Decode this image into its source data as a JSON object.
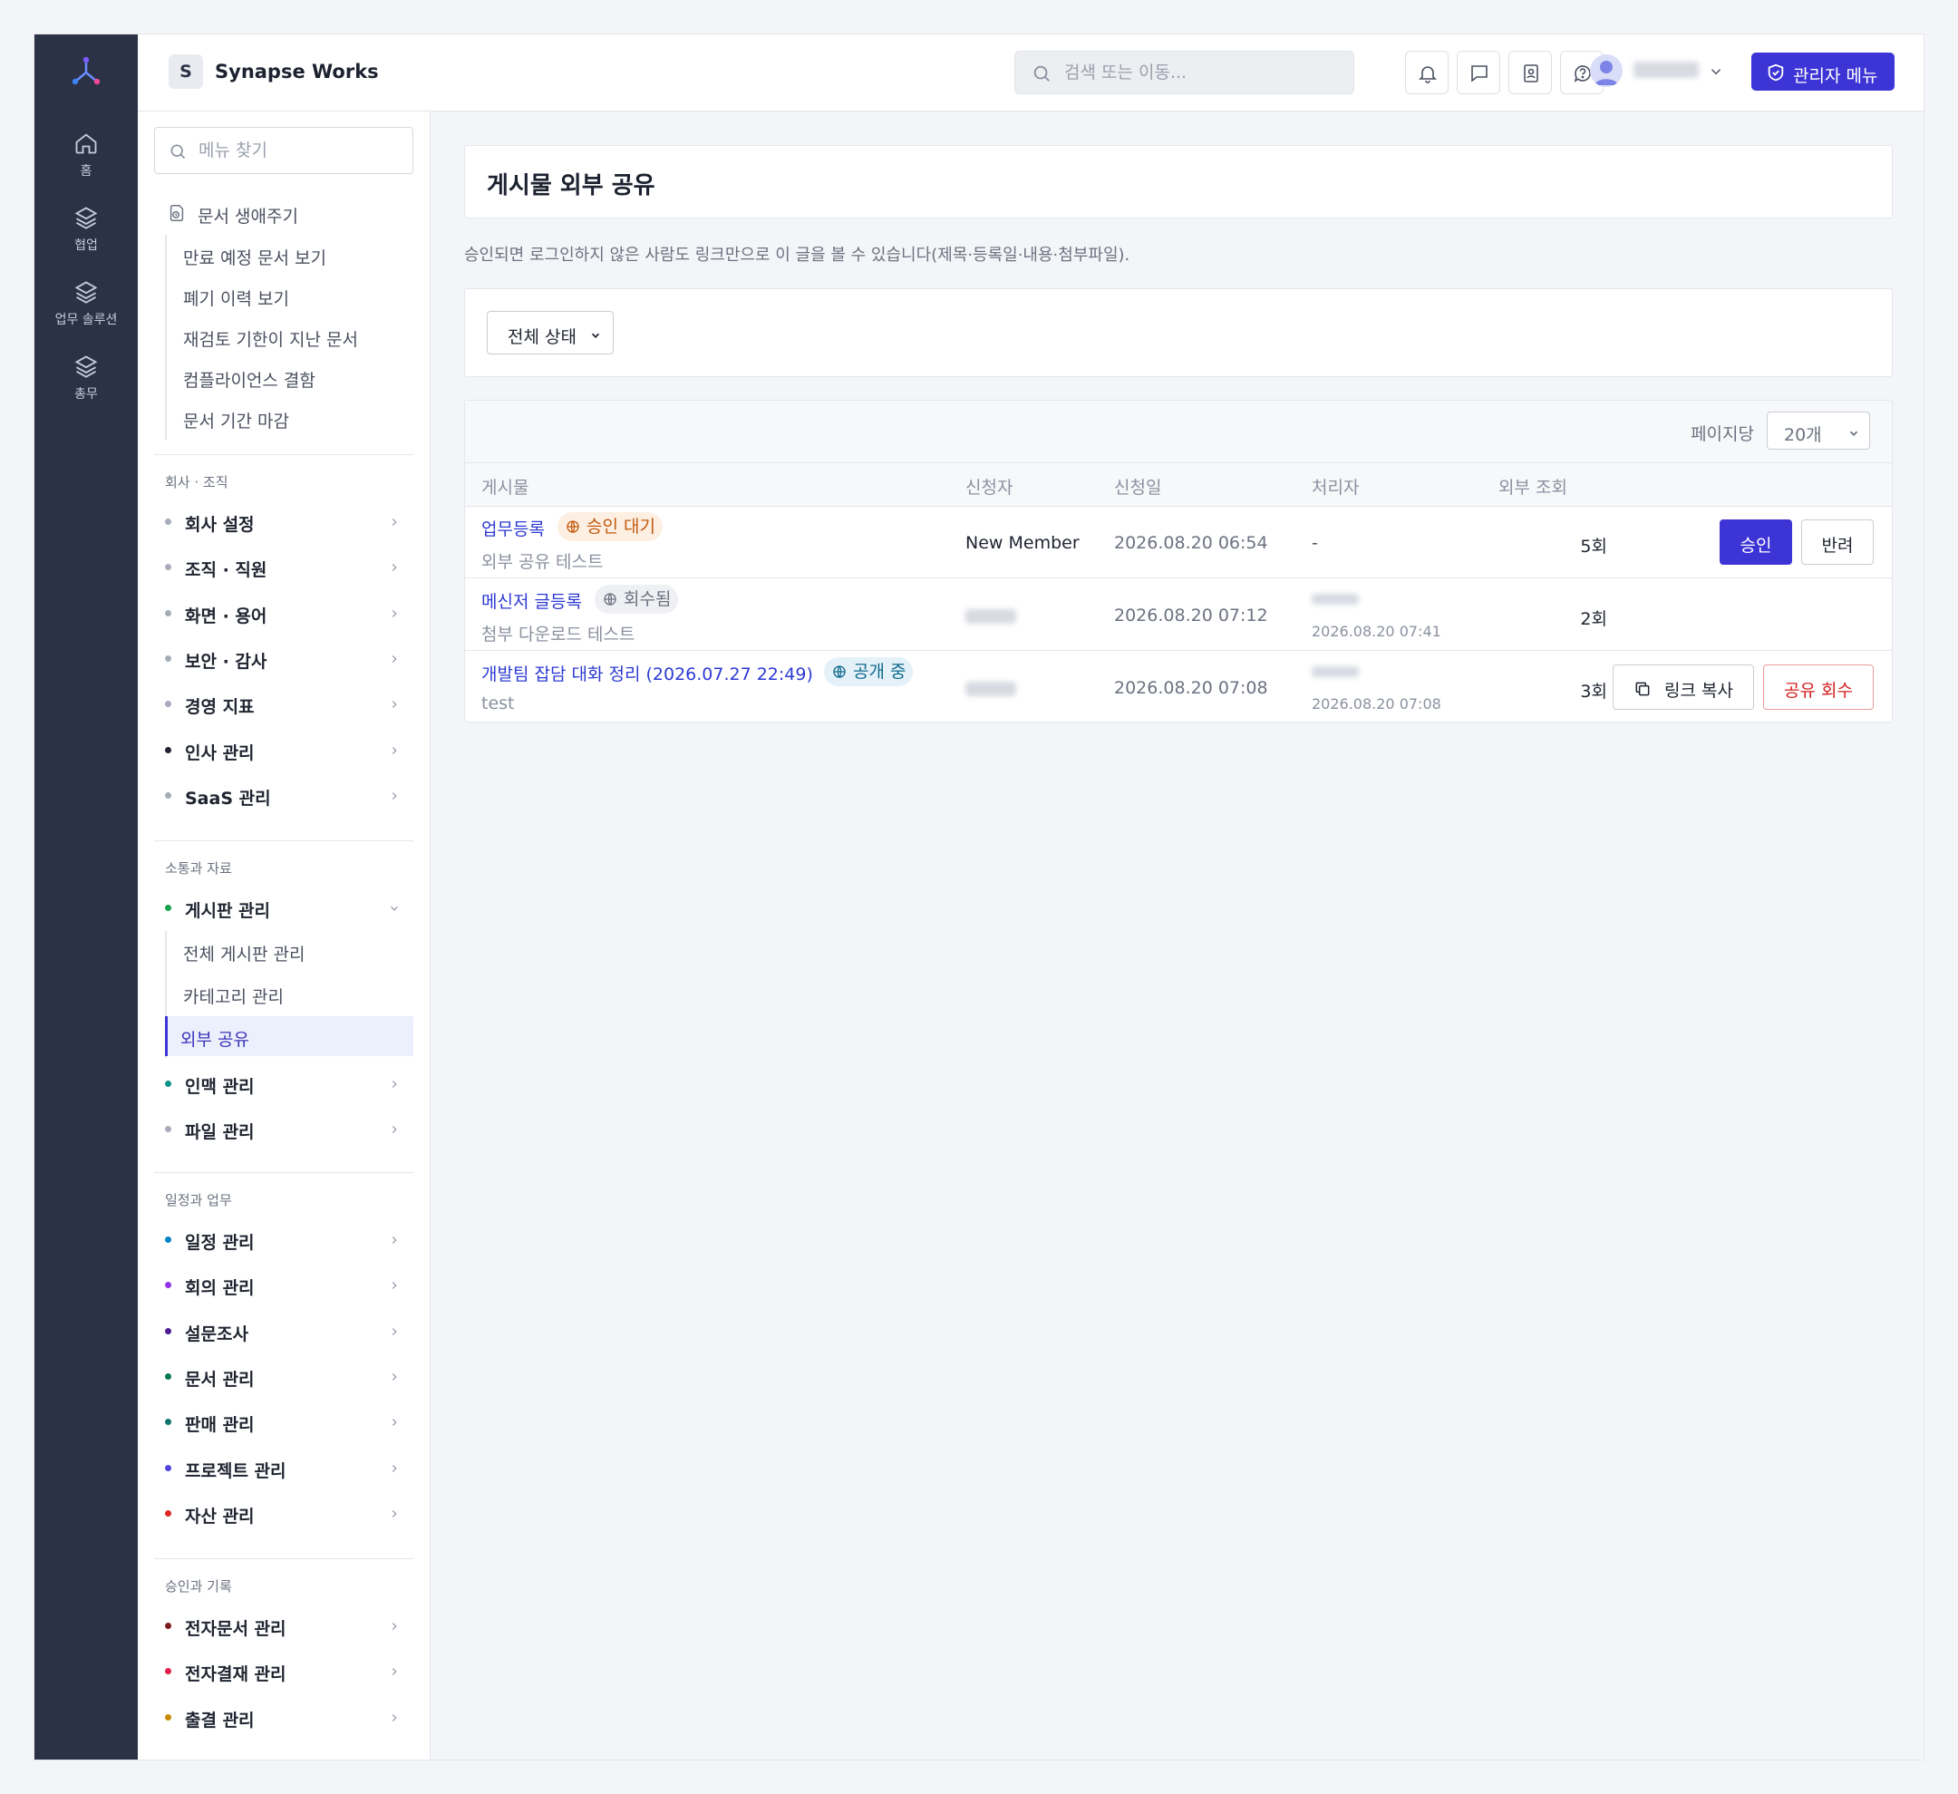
{
  "rail": {
    "items": [
      {
        "label": "홈",
        "icon": "home-icon"
      },
      {
        "label": "협업",
        "icon": "layers-icon"
      },
      {
        "label": "업무 솔루션",
        "icon": "layers-icon"
      },
      {
        "label": "총무",
        "icon": "layers-icon"
      }
    ]
  },
  "topbar": {
    "workspace_badge": "S",
    "workspace_name": "Synapse Works",
    "search_placeholder": "검색 또는 이동...",
    "admin_label": "관리자 메뉴"
  },
  "sidebar": {
    "search_placeholder": "메뉴 찾기",
    "lifecycle": {
      "label": "문서 생애주기",
      "items": [
        "만료 예정 문서 보기",
        "폐기 이력 보기",
        "재검토 기한이 지난 문서",
        "컴플라이언스 결함",
        "문서 기간 마감"
      ]
    },
    "sections": [
      {
        "title": "회사 · 조직",
        "items": [
          {
            "label": "회사 설정",
            "color": "#a7adb8"
          },
          {
            "label": "조직 · 직원",
            "color": "#a7adb8"
          },
          {
            "label": "화면 · 용어",
            "color": "#a7adb8"
          },
          {
            "label": "보안 · 감사",
            "color": "#a7adb8"
          },
          {
            "label": "경영 지표",
            "color": "#a7adb8"
          },
          {
            "label": "인사 관리",
            "color": "#1f2430"
          },
          {
            "label": "SaaS 관리",
            "color": "#a7adb8"
          }
        ]
      },
      {
        "title": "소통과 자료",
        "items": [
          {
            "label": "게시판 관리",
            "color": "#16a34a"
          },
          {
            "label": "인맥 관리",
            "color": "#0d9488"
          },
          {
            "label": "파일 관리",
            "color": "#a7adb8"
          }
        ],
        "board_sub": [
          "전체 게시판 관리",
          "카테고리 관리",
          "외부 공유"
        ]
      },
      {
        "title": "일정과 업무",
        "items": [
          {
            "label": "일정 관리",
            "color": "#0284c7"
          },
          {
            "label": "회의 관리",
            "color": "#9333ea"
          },
          {
            "label": "설문조사",
            "color": "#4c1d95"
          },
          {
            "label": "문서 관리",
            "color": "#047857"
          },
          {
            "label": "판매 관리",
            "color": "#0f766e"
          },
          {
            "label": "프로젝트 관리",
            "color": "#4f46e5"
          },
          {
            "label": "자산 관리",
            "color": "#dc2626"
          }
        ]
      },
      {
        "title": "승인과 기록",
        "items": [
          {
            "label": "전자문서 관리",
            "color": "#7f1d1d"
          },
          {
            "label": "전자결재 관리",
            "color": "#e11d48"
          },
          {
            "label": "출결 관리",
            "color": "#ca8a04"
          }
        ]
      }
    ]
  },
  "main": {
    "title": "게시물 외부 공유",
    "description": "승인되면 로그인하지 않은 사람도 링크만으로 이 글을 볼 수 있습니다(제목·등록일·내용·첨부파일).",
    "status_filter": "전체 상태",
    "per_page_label": "페이지당",
    "per_page_value": "20개",
    "columns": [
      "게시물",
      "신청자",
      "신청일",
      "처리자",
      "외부 조회"
    ],
    "rows": [
      {
        "title": "업무등록",
        "status": "승인 대기",
        "subtitle": "외부 공유 테스트",
        "requester": "New Member",
        "requested_at": "2026.08.20 06:54",
        "processor": "-",
        "processed_at": "",
        "views": "5회",
        "actions": [
          "승인",
          "반려"
        ]
      },
      {
        "title": "메신저 글등록",
        "status": "회수됨",
        "subtitle": "첨부 다운로드 테스트",
        "requester": "",
        "requested_at": "2026.08.20 07:12",
        "processor": "",
        "processed_at": "2026.08.20 07:41",
        "views": "2회",
        "actions": []
      },
      {
        "title": "개발팀 잡담 대화 정리 (2026.07.27 22:49)",
        "status": "공개 중",
        "subtitle": "test",
        "requester": "",
        "requested_at": "2026.08.20 07:08",
        "processor": "",
        "processed_at": "2026.08.20 07:08",
        "views": "3회",
        "actions": [
          "링크 복사",
          "공유 회수"
        ]
      }
    ]
  },
  "colors": {
    "accent": "#3d34d6",
    "rail_bg": "#2b3246",
    "danger": "#d42020"
  }
}
